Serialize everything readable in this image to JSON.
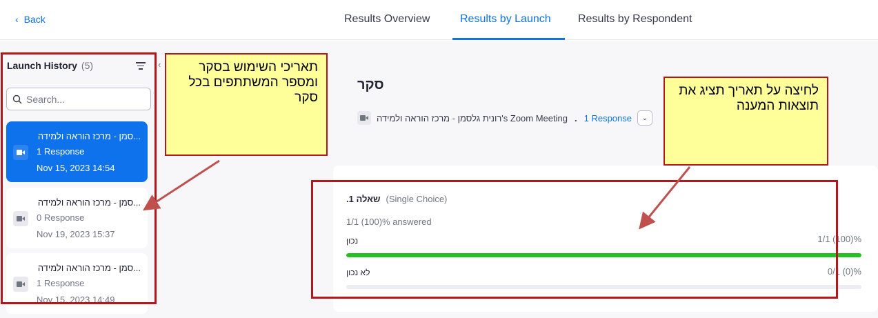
{
  "nav": {
    "back_label": "Back",
    "tabs": [
      {
        "label": "Results Overview"
      },
      {
        "label": "Results by Launch"
      },
      {
        "label": "Results by Respondent"
      }
    ],
    "active_tab": "Results by Launch"
  },
  "sidebar": {
    "title": "Launch History",
    "count": "(5)",
    "search_placeholder": "Search...",
    "launches": [
      {
        "name": "...סמן - מרכז הוראה ולמידה",
        "responses": "1 Response",
        "date": "Nov 15, 2023 14:54",
        "selected": true
      },
      {
        "name": "...סמן - מרכז הוראה ולמידה",
        "responses": "0 Response",
        "date": "Nov 19, 2023 15:37",
        "selected": false
      },
      {
        "name": "...סמן - מרכז הוראה ולמידה",
        "responses": "1 Response",
        "date": "Nov 15, 2023 14:49",
        "selected": false
      }
    ]
  },
  "survey": {
    "title": "סקר",
    "host": "רונית גלסמן - מרכז הוראה ולמידה's Zoom Meeting",
    "separator": ".",
    "responses_link": "1 Response"
  },
  "question": {
    "number_label": "שאלה 1.",
    "type": "(Single Choice)",
    "answered": "1/1 (100)% answered",
    "options": [
      {
        "label": "נכון",
        "value": "1/1 (100)%",
        "fraction": 1.0
      },
      {
        "label": "לא נכון",
        "value": "0/1 (0)%",
        "fraction": 0.0
      }
    ]
  },
  "annotations": {
    "left_callout": "תאריכי השימוש בסקר ומספר המשתתפים בכל סקר",
    "right_callout": "לחיצה על תאריך תציג את תוצאות המענה"
  },
  "colors": {
    "accent": "#0e72ed",
    "bar_green": "#23c123",
    "annotation_red": "#b3171c",
    "callout_yellow": "#ffff99"
  }
}
